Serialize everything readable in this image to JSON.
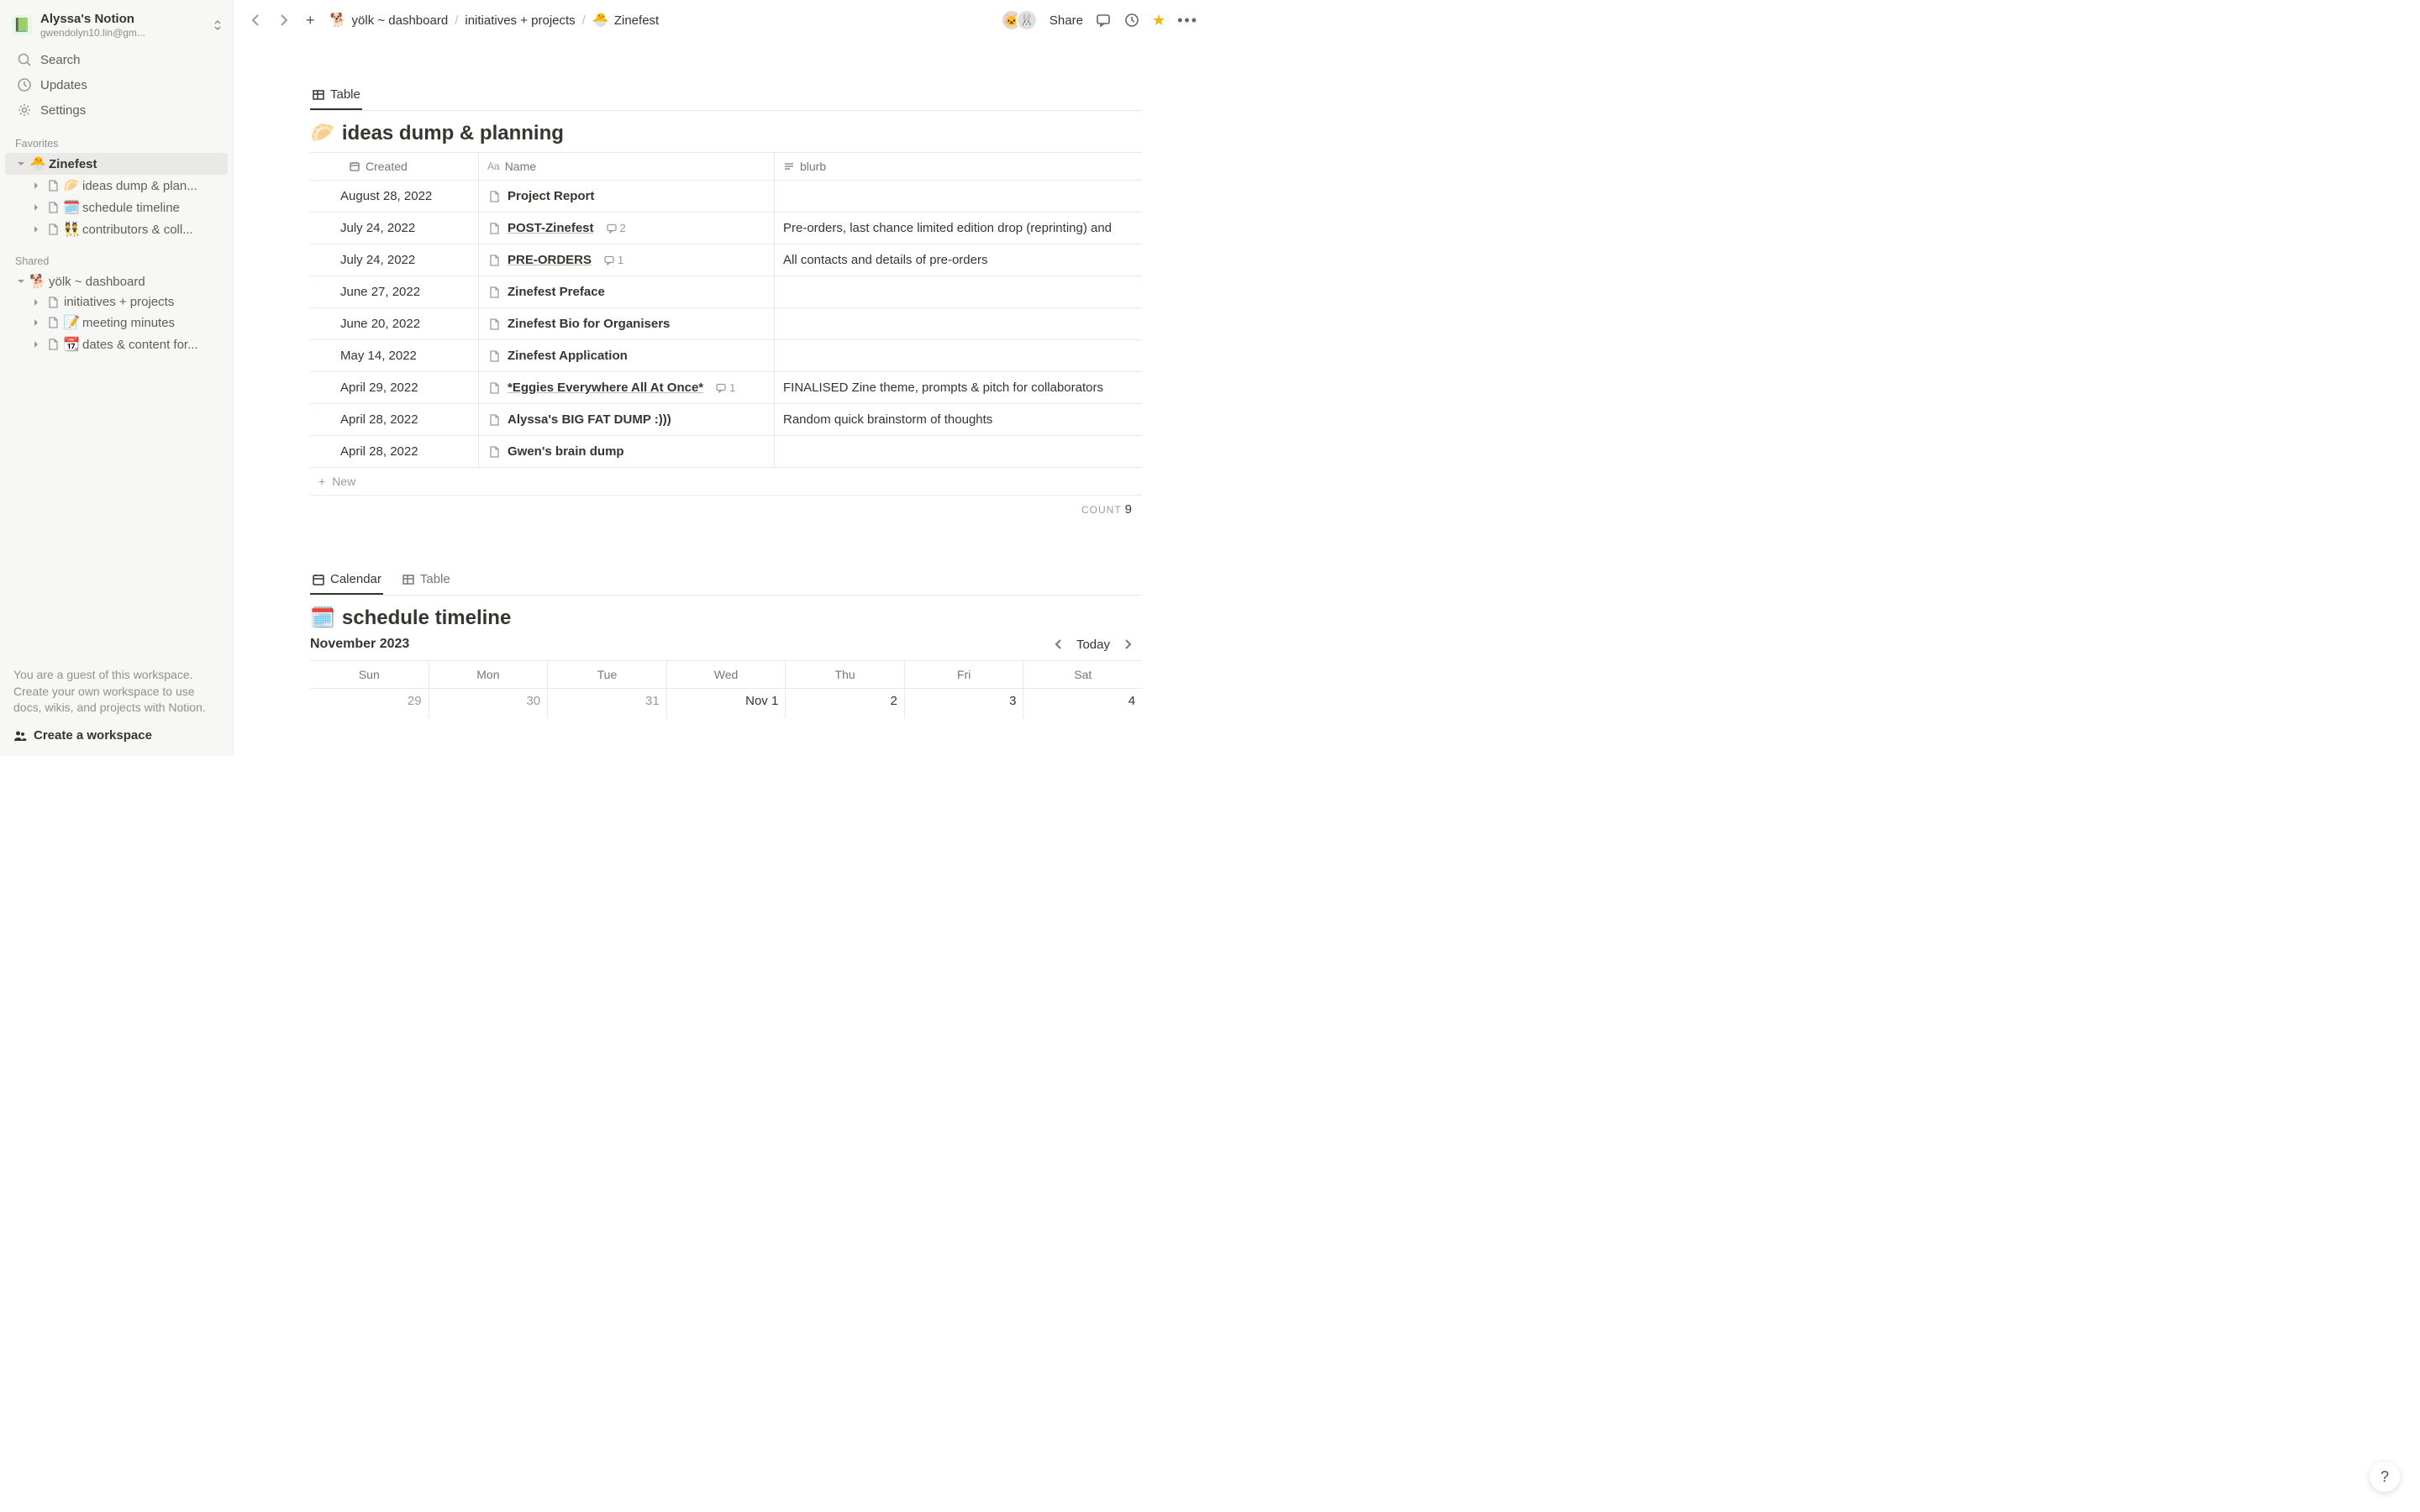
{
  "workspace": {
    "title": "Alyssa's Notion",
    "email": "gwendolyn10.lin@gm..."
  },
  "sidebar": {
    "nav": {
      "search": "Search",
      "updates": "Updates",
      "settings": "Settings"
    },
    "favorites_label": "Favorites",
    "favorites": [
      {
        "emoji": "🐣",
        "label": "Zinefest",
        "active": true,
        "children": [
          {
            "emoji": "🥟",
            "label": "ideas dump & plan..."
          },
          {
            "emoji": "🗓️",
            "label": "schedule timeline"
          },
          {
            "emoji": "👯",
            "label": "contributors & coll..."
          }
        ]
      }
    ],
    "shared_label": "Shared",
    "shared": [
      {
        "emoji": "🐕",
        "label": "yölk ~ dashboard",
        "children": [
          {
            "label": "initiatives + projects"
          },
          {
            "emoji": "📝",
            "label": "meeting minutes"
          },
          {
            "emoji": "📆",
            "label": "dates & content for..."
          }
        ]
      }
    ],
    "guest_msg": "You are a guest of this workspace. Create your own workspace to use docs, wikis, and projects with Notion.",
    "create_ws": "Create a workspace"
  },
  "breadcrumb": [
    {
      "emoji": "🐕",
      "label": "yölk ~ dashboard"
    },
    {
      "label": "initiatives + projects"
    },
    {
      "emoji": "🐣",
      "label": "Zinefest"
    }
  ],
  "topbar": {
    "share": "Share"
  },
  "table_db": {
    "view_tab": "Table",
    "emoji": "🥟",
    "title": "ideas dump & planning",
    "columns": {
      "created": "Created",
      "name": "Name",
      "blurb": "blurb"
    },
    "rows": [
      {
        "created": "August 28, 2022",
        "name": "Project Report",
        "blurb": ""
      },
      {
        "created": "July 24, 2022",
        "name": "POST-Zinefest",
        "underlined": true,
        "comments": "2",
        "blurb": "Pre-orders, last chance limited edition drop (reprinting) and"
      },
      {
        "created": "July 24, 2022",
        "name": "PRE-ORDERS",
        "underlined": true,
        "comments": "1",
        "blurb": "All contacts and details of pre-orders"
      },
      {
        "created": "June 27, 2022",
        "name": "Zinefest Preface",
        "blurb": ""
      },
      {
        "created": "June 20, 2022",
        "name": "Zinefest Bio for Organisers",
        "blurb": ""
      },
      {
        "created": "May 14, 2022",
        "name": "Zinefest Application",
        "blurb": ""
      },
      {
        "created": "April 29, 2022",
        "name": "*Eggies Everywhere All At Once*",
        "underlined": true,
        "comments": "1",
        "blurb": "FINALISED Zine theme, prompts & pitch for collaborators"
      },
      {
        "created": "April 28, 2022",
        "name": "Alyssa's BIG FAT DUMP :)))",
        "blurb": "Random quick brainstorm of thoughts"
      },
      {
        "created": "April 28, 2022",
        "name": "Gwen's brain dump",
        "blurb": ""
      }
    ],
    "new_label": "New",
    "count_label": "COUNT",
    "count_value": "9"
  },
  "calendar_db": {
    "view_tabs": {
      "calendar": "Calendar",
      "table": "Table"
    },
    "emoji": "🗓️",
    "title": "schedule timeline",
    "month": "November 2023",
    "today_label": "Today",
    "days": [
      "Sun",
      "Mon",
      "Tue",
      "Wed",
      "Thu",
      "Fri",
      "Sat"
    ],
    "dates": [
      "29",
      "30",
      "31",
      "Nov 1",
      "2",
      "3",
      "4"
    ],
    "dates_in_month": [
      false,
      false,
      false,
      true,
      true,
      true,
      true
    ]
  },
  "help": "?"
}
